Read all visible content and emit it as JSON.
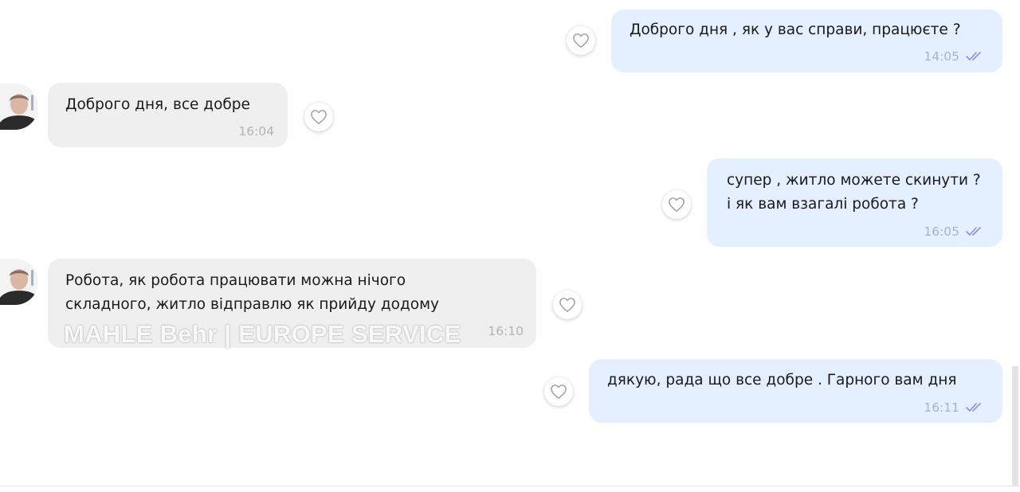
{
  "messages": [
    {
      "direction": "outgoing",
      "text": "Доброго дня , як у вас справи, працюєте ?",
      "time": "14:05",
      "status_icon": "double-check-icon"
    },
    {
      "direction": "incoming",
      "text": "Доброго дня, все добре",
      "time": "16:04",
      "avatar_icon": "user-avatar"
    },
    {
      "direction": "outgoing",
      "text": "супер , житло можете скинути ?\nі як вам взагалі робота ?",
      "time": "16:05",
      "status_icon": "double-check-icon"
    },
    {
      "direction": "incoming",
      "text": "Робота, як робота працювати можна нічого\nскладного, житло відправлю як прийду додому",
      "time": "16:10",
      "avatar_icon": "user-avatar"
    },
    {
      "direction": "outgoing",
      "text": "дякую, рада що все добре . Гарного вам дня",
      "time": "16:11",
      "status_icon": "double-check-icon"
    }
  ],
  "watermark": "MAHLE Behr | EUROPE SERVICE",
  "icons": {
    "reaction": "heart-icon",
    "read_status": "double-check-icon"
  },
  "colors": {
    "outgoing_bubble": "#e4efff",
    "incoming_bubble": "#efefef",
    "check_marks": "#8f8fe0",
    "text": "#1a1a1a"
  }
}
